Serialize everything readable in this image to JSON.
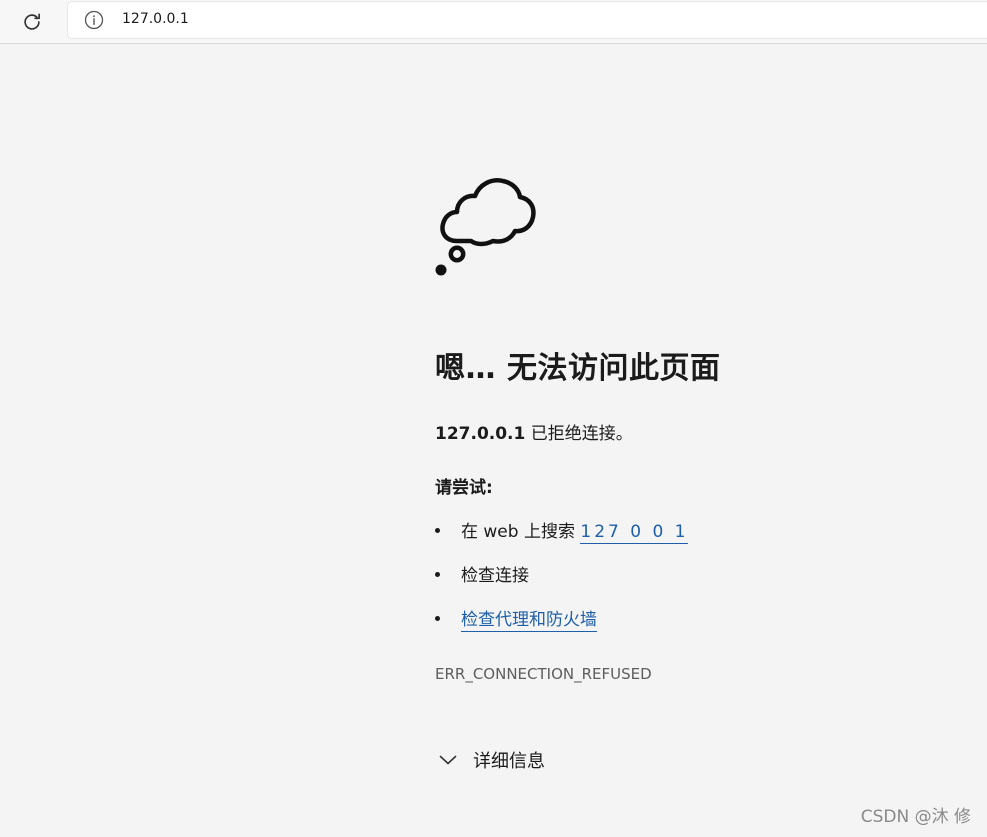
{
  "browser": {
    "url": "127.0.0.1",
    "reload_icon": "reload-icon",
    "info_icon": "info-icon"
  },
  "error_page": {
    "illustration": "thought-cloud-icon",
    "title": "嗯… 无法访问此页面",
    "host": "127.0.0.1",
    "refused_text": " 已拒绝连接。",
    "try_heading": "请尝试:",
    "suggestions": {
      "search_prefix": "在 web 上搜索 ",
      "search_link": "127 0 0 1",
      "check_connection": "检查连接",
      "check_proxy_link": "检查代理和防火墙"
    },
    "error_code": "ERR_CONNECTION_REFUSED",
    "details_label": "详细信息"
  },
  "watermark": "CSDN @沐 修",
  "colors": {
    "background": "#f4f4f4",
    "link": "#1d5fa8",
    "text": "#1b1b1b",
    "muted": "#5d5d5d"
  }
}
